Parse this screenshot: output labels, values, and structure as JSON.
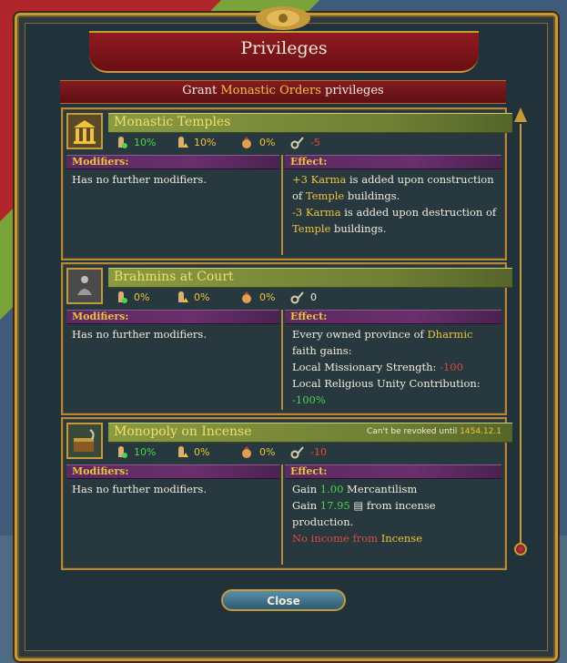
{
  "window": {
    "title": "Privileges",
    "subtitle": {
      "prefix": "Grant",
      "estate": "Monastic Orders",
      "suffix": "privileges"
    }
  },
  "privileges": [
    {
      "name": "Monastic Temples",
      "icon": "temple-icon",
      "revoke_text": "",
      "revoke_date": "",
      "stats": {
        "loyalty": "10%",
        "influence": "10%",
        "land": "0%",
        "karma": "-5"
      },
      "modifiers_label": "Modifiers:",
      "modifiers": "Has no further modifiers.",
      "effect_label": "Effect:",
      "effect_lines": [
        {
          "parts": [
            {
              "t": "+3 Karma",
              "c": "gold"
            },
            {
              "t": " is added upon construction",
              "c": "white"
            }
          ]
        },
        {
          "parts": [
            {
              "t": "of ",
              "c": "white"
            },
            {
              "t": "Temple",
              "c": "gold"
            },
            {
              "t": " buildings.",
              "c": "white"
            }
          ]
        },
        {
          "parts": [
            {
              "t": "-3 Karma",
              "c": "gold"
            },
            {
              "t": " is added upon destruction of",
              "c": "white"
            }
          ]
        },
        {
          "parts": [
            {
              "t": "Temple",
              "c": "gold"
            },
            {
              "t": " buildings.",
              "c": "white"
            }
          ]
        }
      ]
    },
    {
      "name": "Brahmins at Court",
      "icon": "meditating-monk-icon",
      "revoke_text": "",
      "revoke_date": "",
      "stats": {
        "loyalty": "0%",
        "influence": "0%",
        "land": "0%",
        "karma": "0"
      },
      "modifiers_label": "Modifiers:",
      "modifiers": "Has no further modifiers.",
      "effect_label": "Effect:",
      "effect_lines": [
        {
          "parts": [
            {
              "t": "Every owned province of ",
              "c": "white"
            },
            {
              "t": "Dharmic",
              "c": "gold"
            }
          ]
        },
        {
          "parts": [
            {
              "t": "faith gains:",
              "c": "white"
            }
          ]
        },
        {
          "parts": [
            {
              "t": "Local Missionary Strength: ",
              "c": "white"
            },
            {
              "t": "-100",
              "c": "red"
            }
          ]
        },
        {
          "parts": [
            {
              "t": "Local Religious Unity Contribution:",
              "c": "white"
            }
          ]
        },
        {
          "parts": [
            {
              "t": "-100%",
              "c": "green"
            }
          ]
        }
      ]
    },
    {
      "name": "Monopoly on Incense",
      "icon": "incense-chest-icon",
      "revoke_text": "Can't be revoked until",
      "revoke_date": "1454.12.1",
      "stats": {
        "loyalty": "10%",
        "influence": "0%",
        "land": "0%",
        "karma": "-10"
      },
      "modifiers_label": "Modifiers:",
      "modifiers": "Has no further modifiers.",
      "effect_label": "Effect:",
      "effect_lines": [
        {
          "parts": [
            {
              "t": "Gain ",
              "c": "white"
            },
            {
              "t": "1.00",
              "c": "green"
            },
            {
              "t": " Mercantilism",
              "c": "white"
            }
          ]
        },
        {
          "parts": [
            {
              "t": "Gain ",
              "c": "white"
            },
            {
              "t": "17.95",
              "c": "green"
            },
            {
              "t": " ▤ from incense",
              "c": "white"
            }
          ]
        },
        {
          "parts": [
            {
              "t": "production.",
              "c": "white"
            }
          ]
        },
        {
          "parts": [
            {
              "t": "No income from ",
              "c": "red"
            },
            {
              "t": "Incense",
              "c": "gold"
            }
          ]
        }
      ]
    }
  ],
  "buttons": {
    "close": "Close"
  },
  "colors": {
    "gold": "#f0c33a",
    "green": "#4bd44b",
    "red": "#e04a3c"
  }
}
